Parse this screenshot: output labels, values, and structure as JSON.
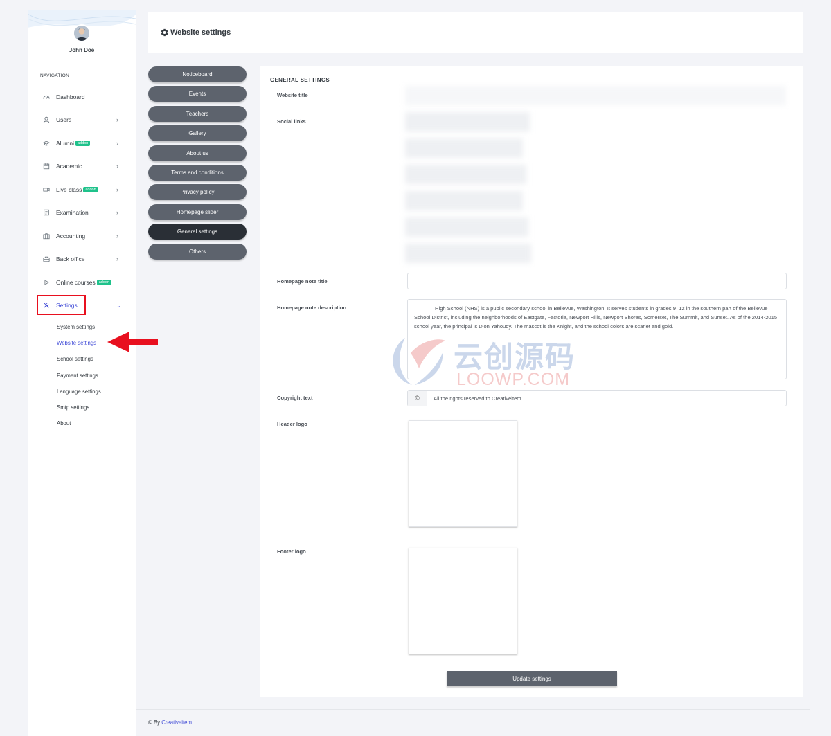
{
  "sidebar": {
    "user_name": "John Doe",
    "nav_heading": "NAVIGATION",
    "items": [
      {
        "label": "Dashboard",
        "icon": "dashboard-icon",
        "chevron": false,
        "badge": ""
      },
      {
        "label": "Users",
        "icon": "user-icon",
        "chevron": true,
        "badge": ""
      },
      {
        "label": "Alumni",
        "icon": "graduation-cap-icon",
        "chevron": true,
        "badge": "addon"
      },
      {
        "label": "Academic",
        "icon": "calendar-icon",
        "chevron": true,
        "badge": ""
      },
      {
        "label": "Live class",
        "icon": "video-icon",
        "chevron": true,
        "badge": "addon"
      },
      {
        "label": "Examination",
        "icon": "document-icon",
        "chevron": true,
        "badge": ""
      },
      {
        "label": "Accounting",
        "icon": "briefcase-icon",
        "chevron": true,
        "badge": ""
      },
      {
        "label": "Back office",
        "icon": "bag-icon",
        "chevron": true,
        "badge": ""
      },
      {
        "label": "Online courses",
        "icon": "play-icon",
        "chevron": false,
        "badge": "addon"
      },
      {
        "label": "Settings",
        "icon": "tools-icon",
        "chevron": true,
        "badge": ""
      }
    ],
    "subitems": [
      "System settings",
      "Website settings",
      "School settings",
      "Payment settings",
      "Language settings",
      "Smtp settings",
      "About"
    ],
    "chevron_right": "›",
    "chevron_down": "⌄"
  },
  "header": {
    "title": "Website settings"
  },
  "pill_menu": [
    "Noticeboard",
    "Events",
    "Teachers",
    "Gallery",
    "About us",
    "Terms and conditions",
    "Privacy policy",
    "Homepage slider",
    "General settings",
    "Others"
  ],
  "form": {
    "section_title": "GENERAL SETTINGS",
    "website_title_label": "Website title",
    "social_links_label": "Social links",
    "homepage_note_title_label": "Homepage note title",
    "homepage_note_title_value": "",
    "homepage_note_description_label": "Homepage note description",
    "homepage_note_description_value": "High School (NHS) is a public secondary school in Bellevue, Washington. It serves students in grades 9–12 in the southern part of the Bellevue School District, including the neighborhoods of Eastgate, Factoria, Newport Hills, Newport Shores, Somerset, The Summit, and Sunset. As of the 2014-2015 school year, the principal is Dion Yahoudy. The mascot is the Knight, and the school colors are scarlet and gold.",
    "copyright_label": "Copyright text",
    "copyright_icon": "©",
    "copyright_value": "All the rights reserved to Creativeitem",
    "header_logo_label": "Header logo",
    "footer_logo_label": "Footer logo",
    "update_button": "Update settings"
  },
  "watermark": {
    "chinese": "云创源码",
    "latin": "LOOWP.COM"
  },
  "footer": {
    "prefix": "© By",
    "link": "Creativeitem"
  },
  "colors": {
    "accent": "#3d48d6",
    "pill": "#5d636d",
    "pill_active": "#2a2f36",
    "badge": "#1fc28b",
    "highlight": "#e8101f"
  }
}
